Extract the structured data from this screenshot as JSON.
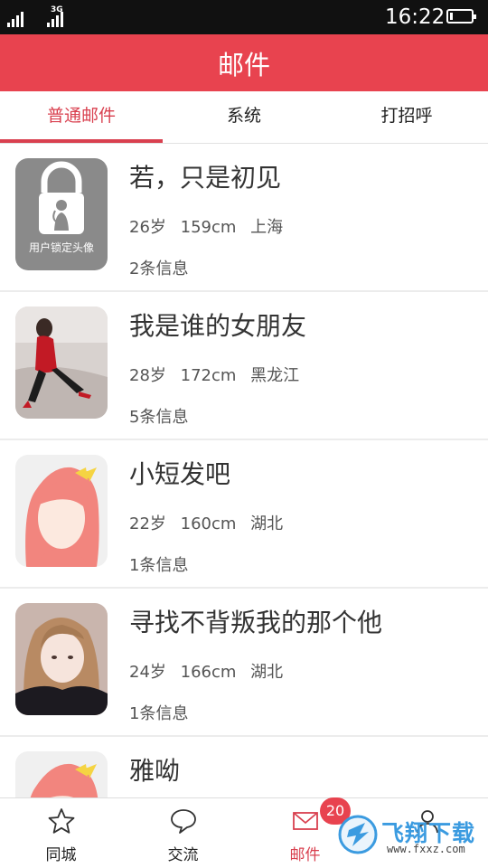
{
  "status_bar": {
    "network_1": "",
    "network_2": "3G",
    "time": "16:22",
    "battery_level": 0.12
  },
  "header": {
    "title": "邮件"
  },
  "tabs": [
    {
      "label": "普通邮件",
      "active": true
    },
    {
      "label": "系统",
      "active": false
    },
    {
      "label": "打招呼",
      "active": false
    }
  ],
  "messages": [
    {
      "name": "若，只是初见",
      "age": "26岁",
      "height": "159cm",
      "location": "上海",
      "count": "2条信息",
      "avatar": "locked-avatar",
      "avatar_caption": "用户锁定头像"
    },
    {
      "name": "我是谁的女朋友",
      "age": "28岁",
      "height": "172cm",
      "location": "黑龙江",
      "count": "5条信息",
      "avatar": "photo-woman-red-dress"
    },
    {
      "name": "小短发吧",
      "age": "22岁",
      "height": "160cm",
      "location": "湖北",
      "count": "1条信息",
      "avatar": "default-female-avatar"
    },
    {
      "name": "寻找不背叛我的那个他",
      "age": "24岁",
      "height": "166cm",
      "location": "湖北",
      "count": "1条信息",
      "avatar": "photo-woman-portrait"
    },
    {
      "name": "雅呦",
      "age": "",
      "height": "",
      "location": "",
      "count": "",
      "avatar": "default-female-avatar"
    }
  ],
  "bottom_nav": [
    {
      "label": "同城",
      "icon": "star-icon",
      "active": false
    },
    {
      "label": "交流",
      "icon": "chat-bubble-icon",
      "active": false
    },
    {
      "label": "邮件",
      "icon": "mail-icon",
      "active": true
    },
    {
      "label": "",
      "icon": "person-icon",
      "active": false
    }
  ],
  "badge": {
    "count": "20"
  },
  "watermark": {
    "text": "飞翔下载",
    "url": "www.fxxz.com"
  },
  "colors": {
    "brand": "#e8434f",
    "active_tab": "#d9404f",
    "status_bar": "#111111"
  }
}
